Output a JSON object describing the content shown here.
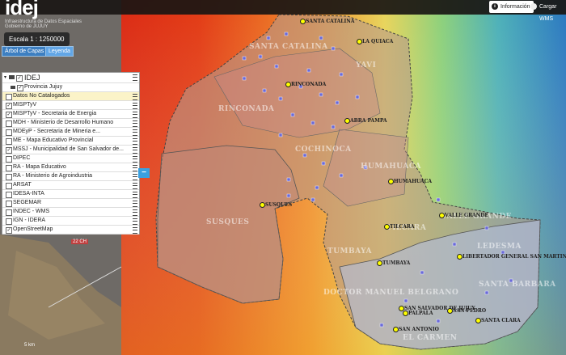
{
  "app": {
    "logo_text": "idej",
    "logo_sub1": "Infraestructura de Datos Espaciales",
    "logo_sub2": "Gobierno de JUJUY",
    "scale": "Escala 1 : 1250000"
  },
  "tabs": [
    {
      "label": "Árbol de Capas"
    },
    {
      "label": "Leyenda"
    }
  ],
  "toolbar": {
    "info_label": "Información",
    "wms_label": "Cargar WMS"
  },
  "layers": {
    "root": "IDEJ",
    "province": "Provincia Jujuy",
    "items": [
      {
        "label": "Datos No Catalogados",
        "checked": false,
        "highlight": true
      },
      {
        "label": "MISPTyV",
        "checked": true
      },
      {
        "label": "MISPTyV - Secretaria de Energia",
        "checked": true
      },
      {
        "label": "MDH - Ministerio de Desarrollo Humano",
        "checked": false
      },
      {
        "label": "MDEyP - Secretaria de Mineria e...",
        "checked": false
      },
      {
        "label": "ME - Mapa Educativo Provincial",
        "checked": false
      },
      {
        "label": "MSSJ - Municipalidad de San Salvador de...",
        "checked": true
      },
      {
        "label": "DIPEC",
        "checked": false
      },
      {
        "label": "RA - Mapa Educativo",
        "checked": false
      },
      {
        "label": "RA - Ministerio de Agroindustria",
        "checked": false
      },
      {
        "label": "ARSAT",
        "checked": false
      },
      {
        "label": "IDESA-INTA",
        "checked": false
      },
      {
        "label": "SEGEMAR",
        "checked": false
      },
      {
        "label": "INDEC - WMS",
        "checked": false
      },
      {
        "label": "IGN - IDERA",
        "checked": false
      },
      {
        "label": "OpenStreetMap",
        "checked": true
      }
    ]
  },
  "collapse_label": "−",
  "map": {
    "departments": [
      "SANTA CATALINA",
      "YAVI",
      "RINCONADA",
      "COCHINOCA",
      "HUMAHUACA",
      "SUSQUES",
      "TUMBAYA",
      "TILCARA",
      "VALLE GRANDE",
      "DOCTOR MANUEL BELGRANO",
      "SANTA BARBARA",
      "EL CARMEN",
      "LEDESMA"
    ],
    "towns": [
      "SANTA CATALINA",
      "LA QUIACA",
      "RINCONADA",
      "ABRA PAMPA",
      "HUMAHUACA",
      "SUSQUES",
      "TILCARA",
      "VALLE GRANDE",
      "TUMBAYA",
      "LIBERTADOR GENERAL SAN MARTIN",
      "SAN SALVADOR DE JUJUY",
      "PALPALA",
      "SAN PEDRO",
      "SANTA CLARA",
      "SAN ANTONIO"
    ],
    "scale_bar": "5 km",
    "road_label": "22 CH"
  }
}
